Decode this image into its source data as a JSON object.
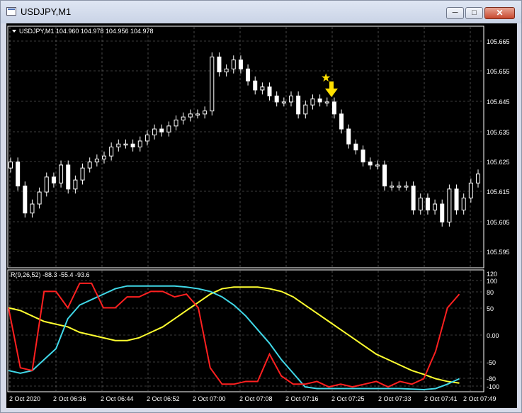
{
  "window": {
    "title": "USDJPY,M1",
    "minimize_glyph": "─",
    "maximize_glyph": "□",
    "close_glyph": "✕",
    "icon": "chart-window-icon"
  },
  "main_chart": {
    "header": "USDJPY,M1  104.960 104.978 104.956 104.978",
    "y_ticks": [
      "105.665",
      "105.655",
      "105.645",
      "105.635",
      "105.625",
      "105.615",
      "105.605",
      "105.595"
    ],
    "star_icon": "★",
    "arrow_icon": "down-arrow-icon",
    "colors": {
      "background": "#000000",
      "bull": "#ffffff",
      "bear": "#ffffff",
      "grid": "#7a7a7a",
      "marker": "#ffe000"
    }
  },
  "indicator": {
    "header": "R(9,26,52) -88.3 -55.4 -93.6",
    "y_ticks": [
      "120",
      "100",
      "80",
      "50",
      "0.00",
      "-50",
      "-80",
      "-100"
    ],
    "colors": {
      "fast": "#ff2020",
      "mid": "#40d8e8",
      "slow": "#ffff30"
    }
  },
  "x_ticks": [
    "2 Oct 2020",
    "2 Oct 06:36",
    "2 Oct 06:44",
    "2 Oct 06:52",
    "2 Oct 07:00",
    "2 Oct 07:08",
    "2 Oct 07:16",
    "2 Oct 07:25",
    "2 Oct 07:33",
    "2 Oct 07:41",
    "2 Oct 07:49"
  ],
  "chart_data": {
    "type": "candlestick",
    "title": "USDJPY,M1",
    "ylim": [
      105.59,
      105.67
    ],
    "candles_close_approx": [
      105.625,
      105.617,
      105.608,
      105.611,
      105.615,
      105.62,
      105.618,
      105.624,
      105.616,
      105.619,
      105.623,
      105.625,
      105.626,
      105.627,
      105.63,
      105.631,
      105.631,
      105.63,
      105.632,
      105.634,
      105.636,
      105.635,
      105.637,
      105.639,
      105.64,
      105.641,
      105.641,
      105.642,
      105.66,
      105.655,
      105.656,
      105.659,
      105.656,
      105.652,
      105.649,
      105.65,
      105.647,
      105.645,
      105.645,
      105.647,
      105.641,
      105.644,
      105.646,
      105.645,
      105.645,
      105.641,
      105.636,
      105.631,
      105.629,
      105.625,
      105.624,
      105.624,
      105.617,
      105.617,
      105.617,
      105.617,
      105.609,
      105.613,
      105.609,
      105.611,
      105.605,
      105.616,
      105.609,
      105.613,
      105.618,
      105.621
    ],
    "indicator_series": [
      {
        "name": "R(9)",
        "last": -88.3
      },
      {
        "name": "R(26)",
        "last": -55.4
      },
      {
        "name": "R(52)",
        "last": -93.6
      }
    ],
    "indicator_ylim": [
      -105,
      120
    ]
  }
}
